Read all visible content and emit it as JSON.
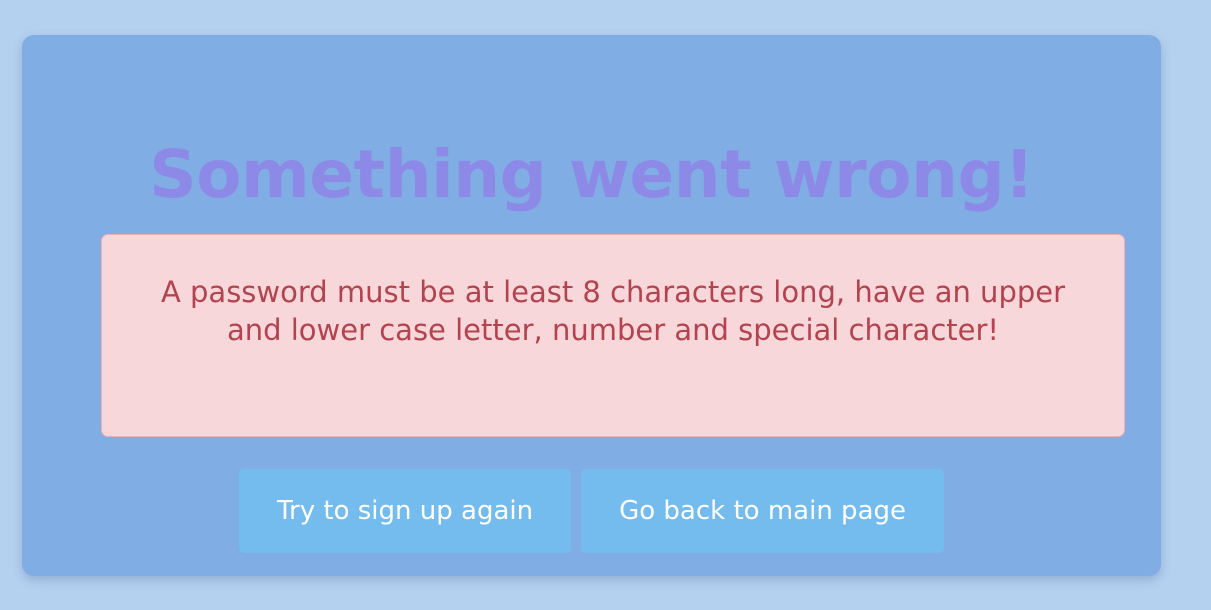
{
  "error_card": {
    "title": "Something went wrong!",
    "message": "A password must be at least 8 characters long, have an upper and lower case letter, number and special character!",
    "buttons": {
      "retry_label": "Try to sign up again",
      "home_label": "Go back to main page"
    }
  },
  "colors": {
    "page_background": "#b5d1f0",
    "card_background": "#81ade5",
    "title_text": "#8c8ae6",
    "alert_background": "#f8d7da",
    "alert_text": "#b3434f",
    "button_background": "#75bcee",
    "button_text": "#ffffff"
  }
}
